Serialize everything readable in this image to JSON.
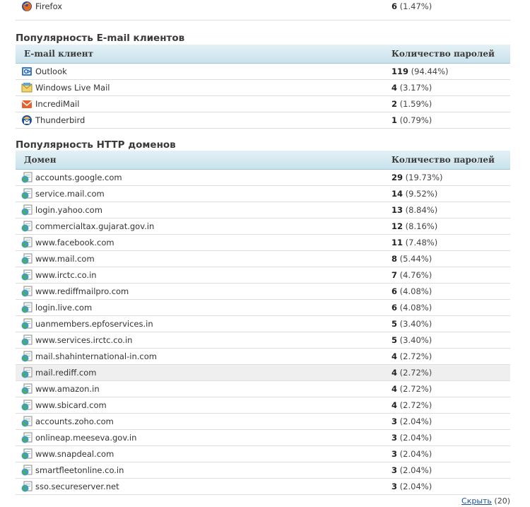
{
  "browser_rows": [
    {
      "name": "Firefox",
      "count": "6",
      "percent": "(1.47%)"
    }
  ],
  "email_section": {
    "title": "Популярность E-mail клиентов",
    "col1": "E-mail клиент",
    "col2": "Количество паролей",
    "rows": [
      {
        "name": "Outlook",
        "count": "119",
        "percent": "(94.44%)",
        "icon": "outlook-icon"
      },
      {
        "name": "Windows Live Mail",
        "count": "4",
        "percent": "(3.17%)",
        "icon": "windows-live-mail-icon"
      },
      {
        "name": "IncrediMail",
        "count": "2",
        "percent": "(1.59%)",
        "icon": "incredimail-icon"
      },
      {
        "name": "Thunderbird",
        "count": "1",
        "percent": "(0.79%)",
        "icon": "thunderbird-icon"
      }
    ]
  },
  "http_section": {
    "title": "Популярность HTTP доменов",
    "col1": "Домен",
    "col2": "Количество паролей",
    "rows": [
      {
        "name": "accounts.google.com",
        "count": "29",
        "percent": "(19.73%)"
      },
      {
        "name": "service.mail.com",
        "count": "14",
        "percent": "(9.52%)"
      },
      {
        "name": "login.yahoo.com",
        "count": "13",
        "percent": "(8.84%)"
      },
      {
        "name": "commercialtax.gujarat.gov.in",
        "count": "12",
        "percent": "(8.16%)"
      },
      {
        "name": "www.facebook.com",
        "count": "11",
        "percent": "(7.48%)"
      },
      {
        "name": "www.mail.com",
        "count": "8",
        "percent": "(5.44%)"
      },
      {
        "name": "www.irctc.co.in",
        "count": "7",
        "percent": "(4.76%)"
      },
      {
        "name": "www.rediffmailpro.com",
        "count": "6",
        "percent": "(4.08%)"
      },
      {
        "name": "login.live.com",
        "count": "6",
        "percent": "(4.08%)"
      },
      {
        "name": "uanmembers.epfoservices.in",
        "count": "5",
        "percent": "(3.40%)"
      },
      {
        "name": "www.services.irctc.co.in",
        "count": "5",
        "percent": "(3.40%)"
      },
      {
        "name": "mail.shahinternational-in.com",
        "count": "4",
        "percent": "(2.72%)"
      },
      {
        "name": "mail.rediff.com",
        "count": "4",
        "percent": "(2.72%)",
        "highlight": true
      },
      {
        "name": "www.amazon.in",
        "count": "4",
        "percent": "(2.72%)"
      },
      {
        "name": "www.sbicard.com",
        "count": "4",
        "percent": "(2.72%)"
      },
      {
        "name": "accounts.zoho.com",
        "count": "3",
        "percent": "(2.04%)"
      },
      {
        "name": "onlineap.meeseva.gov.in",
        "count": "3",
        "percent": "(2.04%)"
      },
      {
        "name": "www.snapdeal.com",
        "count": "3",
        "percent": "(2.04%)"
      },
      {
        "name": "smartfleetonline.co.in",
        "count": "3",
        "percent": "(2.04%)"
      },
      {
        "name": "sso.secureserver.net",
        "count": "3",
        "percent": "(2.04%)"
      }
    ]
  },
  "footer": {
    "hide_link": "Скрыть",
    "count": "(20)"
  }
}
